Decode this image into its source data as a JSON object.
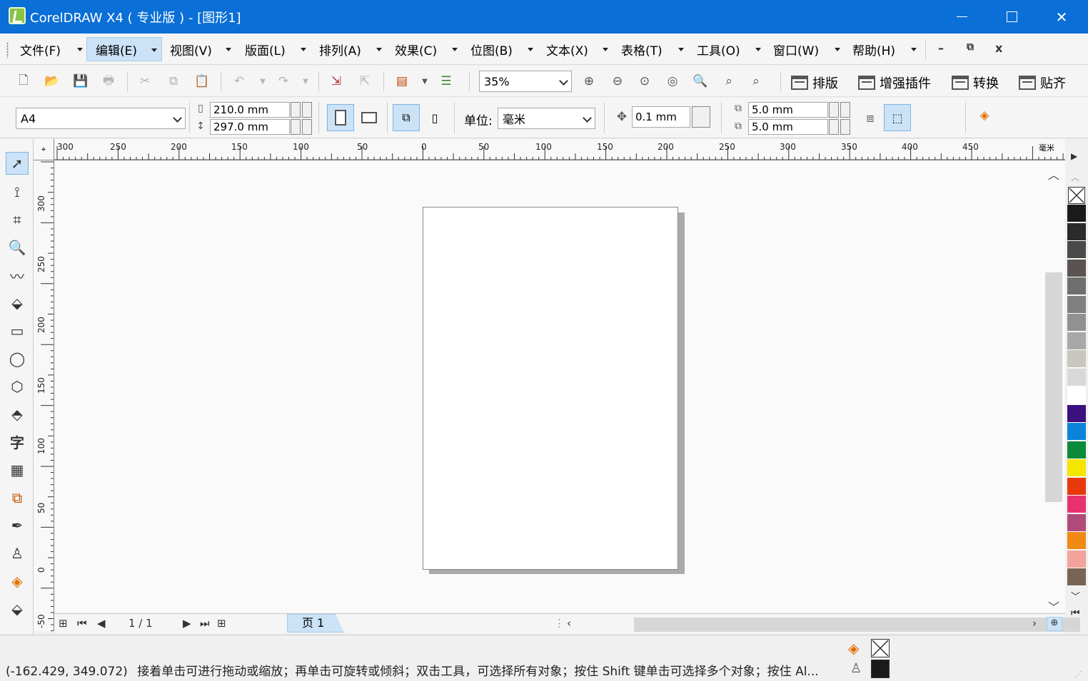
{
  "window": {
    "title": "CorelDRAW X4 ( 专业版 ) - [图形1]"
  },
  "menu": [
    {
      "label": "文件(F)",
      "active": false
    },
    {
      "label": "编辑(E)",
      "active": true
    },
    {
      "label": "视图(V)",
      "active": false
    },
    {
      "label": "版面(L)",
      "active": false
    },
    {
      "label": "排列(A)",
      "active": false
    },
    {
      "label": "效果(C)",
      "active": false
    },
    {
      "label": "位图(B)",
      "active": false
    },
    {
      "label": "文本(X)",
      "active": false
    },
    {
      "label": "表格(T)",
      "active": false
    },
    {
      "label": "工具(O)",
      "active": false
    },
    {
      "label": "窗口(W)",
      "active": false
    },
    {
      "label": "帮助(H)",
      "active": false
    }
  ],
  "toolbar": {
    "zoom": "35%",
    "text_buttons": [
      "排版",
      "增强插件",
      "转换",
      "贴齐"
    ]
  },
  "propertybar": {
    "page_size": "A4",
    "width": "210.0 mm",
    "height": "297.0 mm",
    "unit_label": "单位:",
    "unit": "毫米",
    "nudge": "0.1 mm",
    "dup_x": "5.0 mm",
    "dup_y": "5.0 mm"
  },
  "ruler": {
    "unit": "毫米",
    "h_labels": [
      "300",
      "250",
      "200",
      "150",
      "100",
      "50",
      "0",
      "50",
      "100",
      "150",
      "200",
      "250",
      "300",
      "350",
      "400",
      "450"
    ],
    "v_labels": [
      "300",
      "250",
      "200",
      "150",
      "100",
      "50",
      "0",
      "-50"
    ]
  },
  "pagebar": {
    "counter": "1 / 1",
    "tab": "页 1"
  },
  "palette": [
    "#1a1a1a",
    "#2b2b2b",
    "#4a4a4a",
    "#5b5252",
    "#6e6e6e",
    "#808080",
    "#919191",
    "#a8a8a8",
    "#c8c6bd",
    "#d9d9d9",
    "#ffffff",
    "#3b1180",
    "#0a84d9",
    "#0b8a3a",
    "#f4e600",
    "#e8390b",
    "#e8326e",
    "#b04a7a",
    "#f08a14",
    "#f4a29c",
    "#786455"
  ],
  "status": {
    "coords": "(-162.429, 349.072)",
    "hint": "接着单击可进行拖动或缩放；再单击可旋转或倾斜；双击工具，可选择所有对象；按住 Shift 键单击可选择多个对象；按住 Al..."
  }
}
